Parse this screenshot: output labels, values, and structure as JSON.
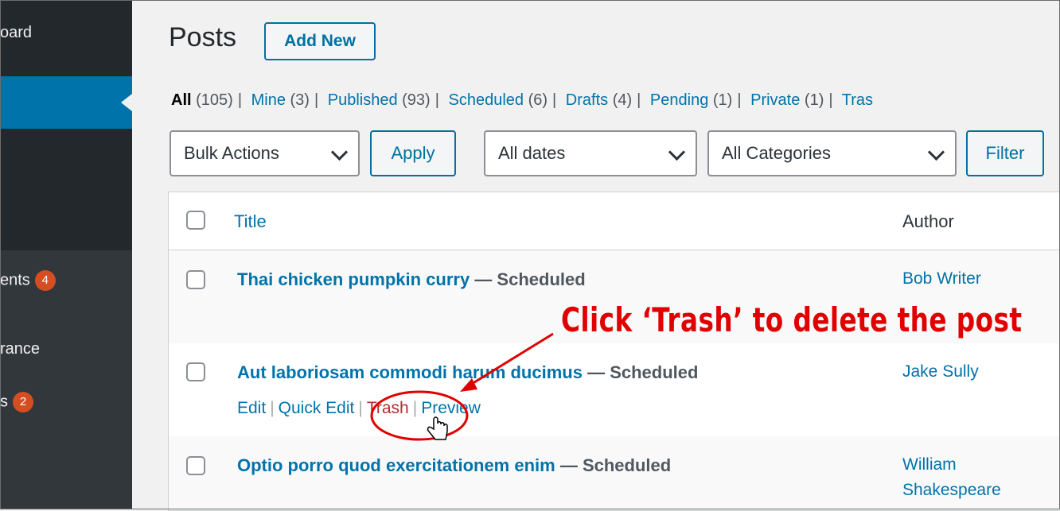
{
  "sidebar": {
    "dashboard_label": "oard",
    "comments_label": "ents",
    "comments_count": "4",
    "appearance_label": "rance",
    "plugins_label": "s",
    "plugins_count": "2"
  },
  "header": {
    "title": "Posts",
    "add_new_label": "Add New"
  },
  "views": [
    {
      "label": "All",
      "count": "(105)"
    },
    {
      "label": "Mine",
      "count": "(3)"
    },
    {
      "label": "Published",
      "count": "(93)"
    },
    {
      "label": "Scheduled",
      "count": "(6)"
    },
    {
      "label": "Drafts",
      "count": "(4)"
    },
    {
      "label": "Pending",
      "count": "(1)"
    },
    {
      "label": "Private",
      "count": "(1)"
    },
    {
      "label": "Tras",
      "count": ""
    }
  ],
  "filters": {
    "bulk_actions": "Bulk Actions",
    "apply_label": "Apply",
    "dates": "All dates",
    "categories": "All Categories",
    "filter_label": "Filter"
  },
  "table": {
    "col_title": "Title",
    "col_author": "Author",
    "rows": [
      {
        "title": "Thai chicken pumpkin curry",
        "state": "— Scheduled",
        "author": "Bob Writer"
      },
      {
        "title": "Aut laboriosam commodi harum ducimus",
        "state": "— Scheduled",
        "author": "Jake Sully"
      },
      {
        "title": "Optio porro quod exercitationem enim",
        "state": "— Scheduled",
        "author": "William Shakespeare"
      }
    ],
    "row_actions": {
      "edit": "Edit",
      "quick_edit": "Quick Edit",
      "trash": "Trash",
      "preview": "Preview"
    }
  },
  "annotation": {
    "callout_text": "Click ‘Trash’ to delete the post",
    "color": "#e00000"
  },
  "colors": {
    "sidebar_bg": "#23282d",
    "sidebar_active": "#0073aa",
    "link": "#0073aa",
    "badge": "#d54e21"
  }
}
